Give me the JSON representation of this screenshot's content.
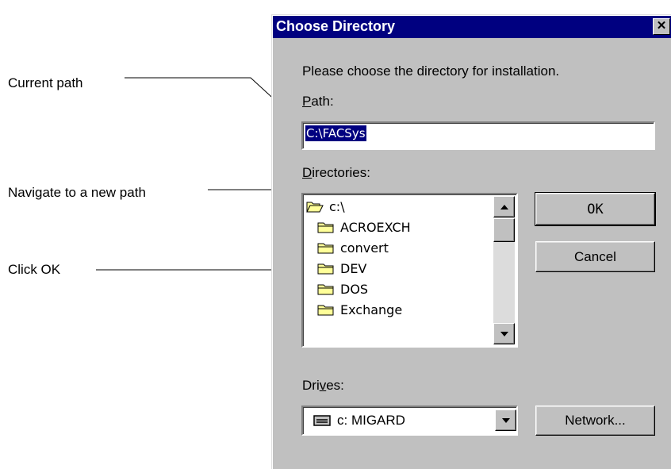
{
  "callouts": {
    "current_path": "Current path",
    "navigate": "Navigate to a new path",
    "click_ok": "Click OK"
  },
  "dialog": {
    "title": "Choose Directory",
    "close_glyph": "✕",
    "prompt": "Please choose the directory for installation.",
    "path_label_mnemonic": "P",
    "path_label_rest": "ath:",
    "path_value": "C:\\FACSys",
    "directories_label_mnemonic": "D",
    "directories_label_rest": "irectories:",
    "directories": [
      {
        "label": "c:\\",
        "icon": "open-folder-icon"
      },
      {
        "label": "ACROEXCH",
        "icon": "folder-icon"
      },
      {
        "label": "convert",
        "icon": "folder-icon"
      },
      {
        "label": "DEV",
        "icon": "folder-icon"
      },
      {
        "label": "DOS",
        "icon": "folder-icon"
      },
      {
        "label": "Exchange",
        "icon": "folder-icon"
      }
    ],
    "ok_label": "OK",
    "cancel_label": "Cancel",
    "drives_label_before": "Dri",
    "drives_label_mnemonic": "v",
    "drives_label_after": "es:",
    "drive_value": "c: MIGARD",
    "drive_icon": "drive-icon",
    "network_label": "Network..."
  },
  "colors": {
    "titlebar": "#000080",
    "dialog_face": "#c0c0c0",
    "selection": "#000080",
    "folder_fill": "#ffff99"
  }
}
